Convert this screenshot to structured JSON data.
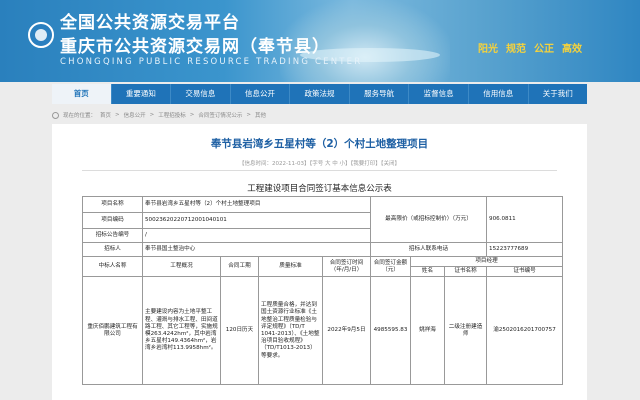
{
  "header": {
    "title1": "全国公共资源交易平台",
    "title2": "重庆市公共资源交易网（奉节县）",
    "english": "CHONGQING PUBLIC RESOURCE TRADING CENTER",
    "slogans": [
      "阳光",
      "规范",
      "公正",
      "高效"
    ],
    "banner_color": "#2a80bd",
    "slogan_color": "#f5d23c"
  },
  "nav": {
    "items": [
      "首页",
      "重要通知",
      "交易信息",
      "信息公开",
      "政策法规",
      "服务导航",
      "监督信息",
      "信用信息",
      "关于我们"
    ],
    "active_color": "#1f73b8"
  },
  "breadcrumb": {
    "items": [
      "现在的位置：",
      "首页",
      "信息公开",
      "工程招投标",
      "合同签订情况公示",
      "其他"
    ]
  },
  "article": {
    "title": "奉节县岩湾乡五星村等（2）个村土地整理项目",
    "meta": "【信息时间：2022-11-03】【字号 大 中 小】【我要打印】【关闭】",
    "subtitle": "工程建设项目合同签订基本信息公示表",
    "title_color": "#1d5fa3"
  },
  "table": {
    "project_name_label": "项目名称",
    "project_name": "奉节县岩湾乡五星村等（2）个村土地整理项目",
    "project_code_label": "项目编码",
    "project_code": "500236202207120010401​01",
    "bid_code_label": "招标公告编号",
    "bid_code": "/",
    "tenderer_label": "招标人",
    "tenderer": "奉节县国土整治中心",
    "max_price_label": "最高限价（或招标控制价）（万元）",
    "max_price": "906.0811",
    "contact_label": "招标人联系电话",
    "contact": "15223777689",
    "headers": {
      "winner": "中标人名称",
      "overview": "工程概况",
      "period": "合同工期",
      "quality": "质量标准",
      "sign_date": "合同签订时间（年/月/日）",
      "amount": "合同签订金额（元）",
      "manager": "项目经理",
      "name": "姓名",
      "cert_type": "证书名称",
      "cert_no": "证书编号"
    },
    "row": {
      "winner": "重庆佰鹏建筑工程有限公司",
      "overview": "主要建设内容为土地平整工程、灌溉与排水工程、田间道路工程、其它工程等，实施规模263.4242hm²，其中岩湾乡五星村149.4364hm²，岩湾乡岩湾村113.9958hm²。",
      "period": "120日历天",
      "quality": "工程质量合格，并达到国土资源行业标准《土地整治工程质量检验与评定规程》（TD/T 1041-2013）、《土地整治项目验收规程》（TD/T1013-2013）等要求。",
      "sign_date": "2022年9月5日",
      "amount": "4985595.83",
      "manager_name": "姚祥海",
      "cert_type": "二级注册建造师",
      "cert_no": "渝2502016201700757"
    }
  }
}
